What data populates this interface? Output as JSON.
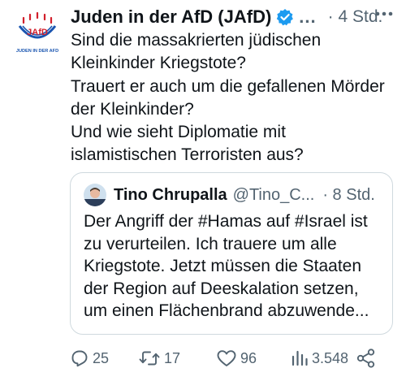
{
  "tweet": {
    "author_name": "Juden in der AfD (JAfD)",
    "ellipsis": "...",
    "time": "· 4 Std.",
    "text_lines": [
      "Sind die massakrierten jüdischen",
      "Kleinkinder Kriegstote?",
      "Trauert er auch um die gefallenen Mörder",
      "der Kleinkinder?",
      "Und wie sieht Diplomatie mit",
      "islamistischen Terroristen aus?"
    ],
    "logo": {
      "top_text": "JAfD",
      "bottom_text": "JUDEN IN DER AFD"
    }
  },
  "quote": {
    "author_name": "Tino Chrupalla",
    "handle": "@Tino_C...",
    "time": "· 8 Std.",
    "text_lines": [
      "Der Angriff der #Hamas auf #Israel ist",
      "zu verurteilen. Ich trauere um alle",
      "Kriegstote. Jetzt müssen die Staaten",
      "der Region auf Deeskalation setzen,",
      "um einen Flächenbrand abzuwende..."
    ]
  },
  "actions": {
    "replies": "25",
    "retweets": "17",
    "likes": "96",
    "views": "3.548"
  },
  "colors": {
    "logo_blue": "#1a55b0",
    "logo_red": "#d21f2b",
    "verified_blue": "#1d9bf0",
    "muted": "#536471",
    "border": "#cfd9de"
  }
}
